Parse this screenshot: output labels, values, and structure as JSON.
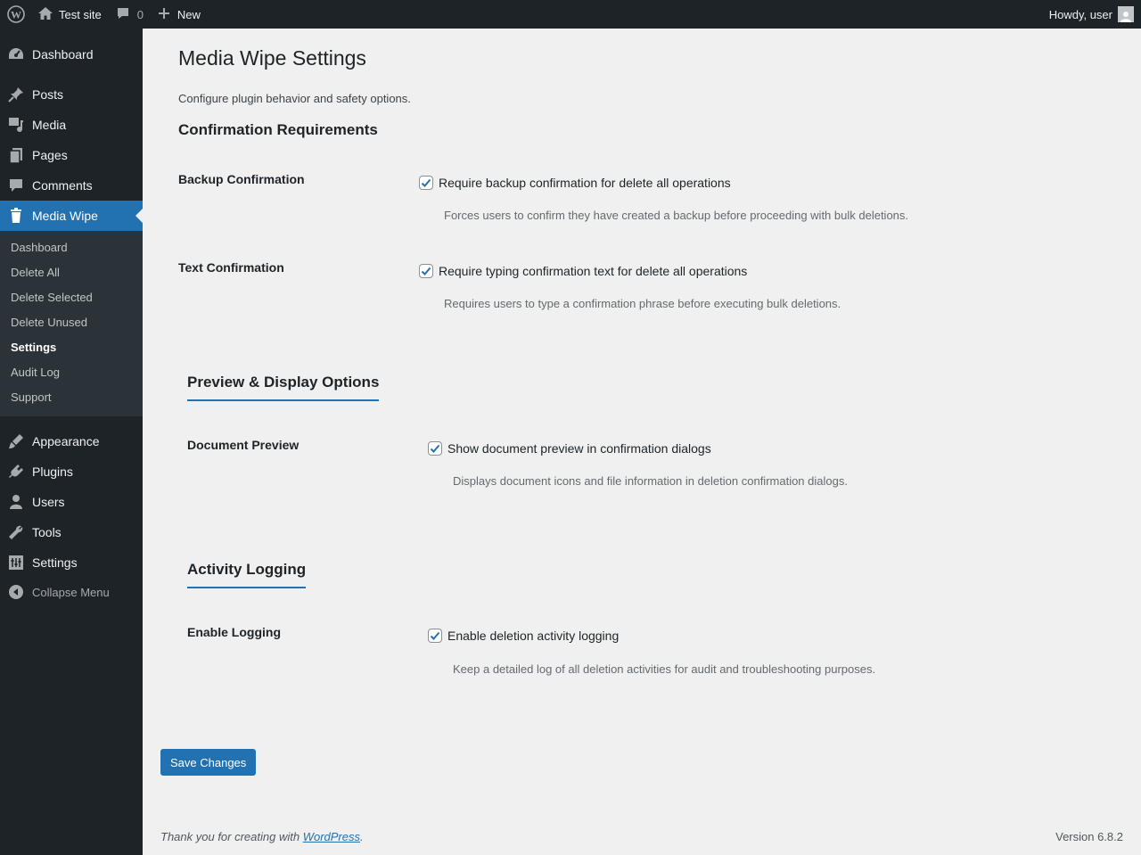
{
  "adminbar": {
    "site_name": "Test site",
    "comments_count": "0",
    "new_label": "New",
    "howdy": "Howdy, user"
  },
  "sidebar": {
    "items": [
      {
        "label": "Dashboard",
        "icon": "dashboard-icon"
      },
      {
        "label": "Posts",
        "icon": "pin-icon"
      },
      {
        "label": "Media",
        "icon": "media-icon"
      },
      {
        "label": "Pages",
        "icon": "pages-icon"
      },
      {
        "label": "Comments",
        "icon": "comment-icon"
      },
      {
        "label": "Media Wipe",
        "icon": "trash-icon"
      },
      {
        "label": "Appearance",
        "icon": "brush-icon"
      },
      {
        "label": "Plugins",
        "icon": "plugin-icon"
      },
      {
        "label": "Users",
        "icon": "user-icon"
      },
      {
        "label": "Tools",
        "icon": "wrench-icon"
      },
      {
        "label": "Settings",
        "icon": "settings-icon"
      }
    ],
    "collapse_label": "Collapse Menu",
    "submenu": [
      "Dashboard",
      "Delete All",
      "Delete Selected",
      "Delete Unused",
      "Settings",
      "Audit Log",
      "Support"
    ],
    "current_submenu": "Settings"
  },
  "main": {
    "title": "Media Wipe Settings",
    "intro": "Configure plugin behavior and safety options.",
    "sections": [
      {
        "heading": "Confirmation Requirements",
        "fields": [
          {
            "label": "Backup Confirmation",
            "checkbox_label": "Require backup confirmation for delete all operations",
            "checked": true,
            "description": "Forces users to confirm they have created a backup before proceeding with bulk deletions."
          },
          {
            "label": "Text Confirmation",
            "checkbox_label": "Require typing confirmation text for delete all operations",
            "checked": true,
            "description": "Requires users to type a confirmation phrase before executing bulk deletions."
          }
        ]
      },
      {
        "heading": "Preview & Display Options",
        "fields": [
          {
            "label": "Document Preview",
            "checkbox_label": "Show document preview in confirmation dialogs",
            "checked": true,
            "description": "Displays document icons and file information in deletion confirmation dialogs."
          }
        ]
      },
      {
        "heading": "Activity Logging",
        "fields": [
          {
            "label": "Enable Logging",
            "checkbox_label": "Enable deletion activity logging",
            "checked": true,
            "description": "Keep a detailed log of all deletion activities for audit and troubleshooting purposes."
          }
        ]
      }
    ],
    "save_label": "Save Changes"
  },
  "footer": {
    "thanks_prefix": "Thank you for creating with ",
    "thanks_link": "WordPress",
    "thanks_suffix": ".",
    "version": "Version 6.8.2"
  },
  "colors": {
    "accent": "#2271b1",
    "sidebar_bg": "#1d2327",
    "submenu_bg": "#2c3338",
    "page_bg": "#f0f0f1"
  }
}
